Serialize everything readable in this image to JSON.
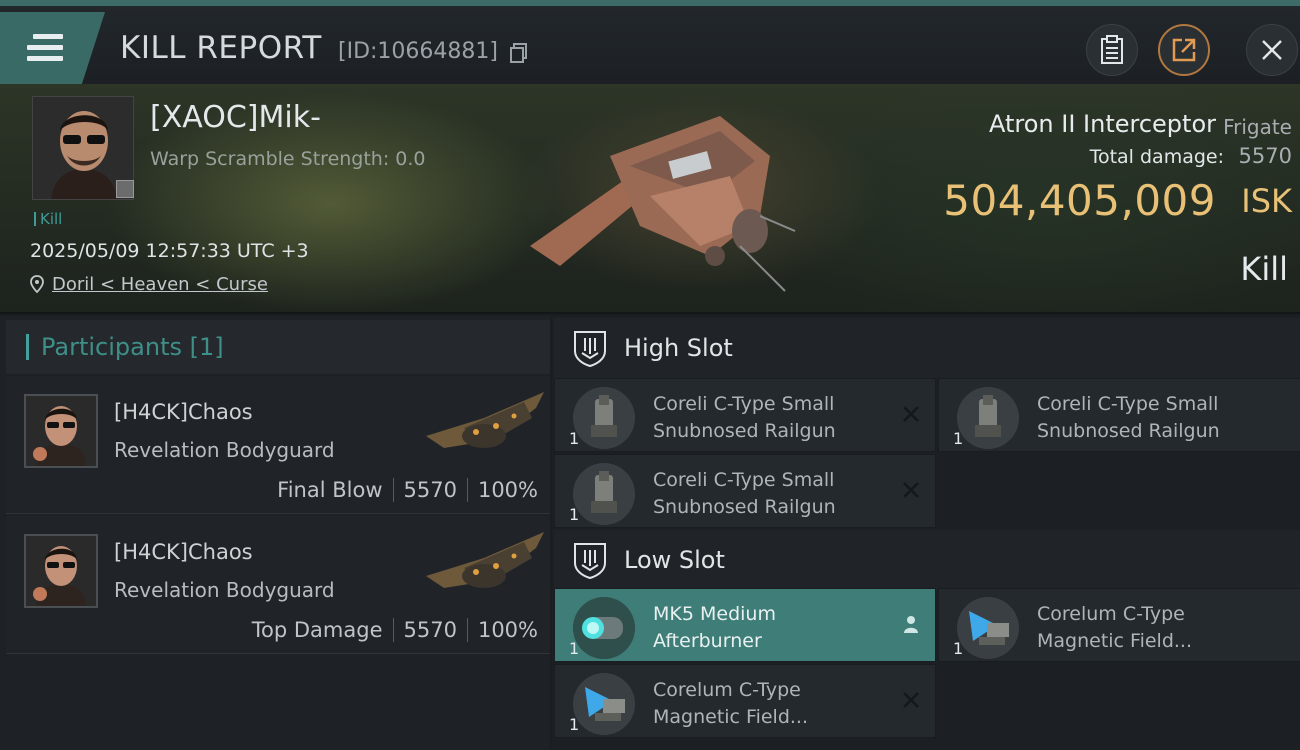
{
  "header": {
    "title": "KILL REPORT",
    "report_id": "[ID:10664881]"
  },
  "victim": {
    "name": "[XAOC]Mik-",
    "warp_scramble": "Warp Scramble Strength: 0.0",
    "kill_tag": "Kill",
    "datetime": "2025/05/09 12:57:33 UTC +3",
    "location": "Doril < Heaven < Curse",
    "ship_name": "Atron II Interceptor",
    "ship_class": "Frigate",
    "total_damage_label": "Total damage:",
    "total_damage": "5570",
    "isk_value": "504,405,009",
    "isk_unit": "ISK",
    "result": "Kill"
  },
  "participants": {
    "header": "Participants [1]",
    "rows": [
      {
        "name": "[H4CK]Chaos",
        "ship": "Revelation Bodyguard",
        "role": "Final Blow",
        "damage": "5570",
        "percent": "100%"
      },
      {
        "name": "[H4CK]Chaos",
        "ship": "Revelation Bodyguard",
        "role": "Top Damage",
        "damage": "5570",
        "percent": "100%"
      }
    ]
  },
  "fitting": {
    "high_slot": {
      "label": "High Slot",
      "modules": [
        {
          "qty": "1",
          "line1": "Coreli C-Type Small",
          "line2": "Snubnosed Railgun",
          "status_icon": "destroyed-x-icon"
        },
        {
          "qty": "1",
          "line1": "Coreli C-Type Small",
          "line2": "Snubnosed Railgun",
          "status_icon": "destroyed-x-icon"
        },
        {
          "qty": "1",
          "line1": "Coreli C-Type Small",
          "line2": "Snubnosed Railgun",
          "status_icon": "destroyed-x-icon"
        }
      ]
    },
    "low_slot": {
      "label": "Low Slot",
      "modules": [
        {
          "qty": "1",
          "line1": "MK5 Medium",
          "line2": "Afterburner",
          "status_icon": "dropped-person-icon"
        },
        {
          "qty": "1",
          "line1": "Corelum C-Type",
          "line2": "Magnetic Field...",
          "status_icon": "destroyed-x-icon"
        },
        {
          "qty": "1",
          "line1": "Corelum C-Type",
          "line2": "Magnetic Field...",
          "status_icon": "destroyed-x-icon"
        }
      ]
    }
  },
  "colors": {
    "accent_teal": "#3f9b95",
    "isk_gold": "#e8c176",
    "active_module": "#3e7d78",
    "header_tab": "#3a6a66"
  }
}
